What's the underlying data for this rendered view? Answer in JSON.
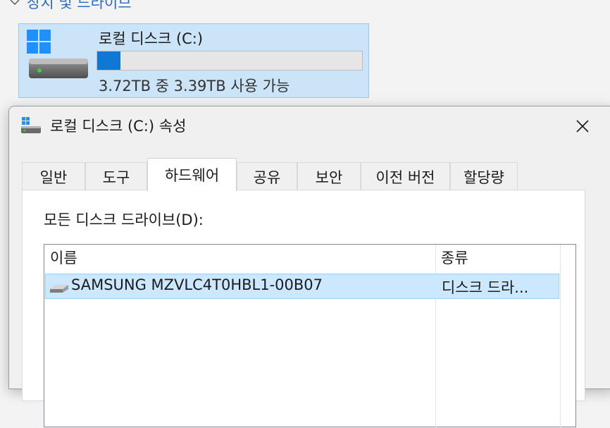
{
  "explorer": {
    "section_title": "장치 및 드라이브",
    "drive": {
      "name": "로컬 디스크 (C:)",
      "space_text": "3.72TB 중 3.39TB 사용 가능",
      "used_fraction": 0.089,
      "bar_color": "#0f78d4"
    }
  },
  "dialog": {
    "title": "로컬 디스크 (C:) 속성",
    "close_icon": "close-icon",
    "tabs": [
      "일반",
      "도구",
      "하드웨어",
      "공유",
      "보안",
      "이전 버전",
      "할당량"
    ],
    "active_tab": "하드웨어",
    "all_disks_label": "모든 디스크 드라이브(D):",
    "list": {
      "columns": [
        "이름",
        "종류"
      ],
      "rows": [
        {
          "name": "SAMSUNG MZVLC4T0HBL1-00B07",
          "type": "디스크 드라..."
        }
      ]
    }
  },
  "colors": {
    "accent": "#0f78d4",
    "selection": "#cce8ff",
    "tile": "#cce4f7",
    "link": "#2b6cc4"
  }
}
